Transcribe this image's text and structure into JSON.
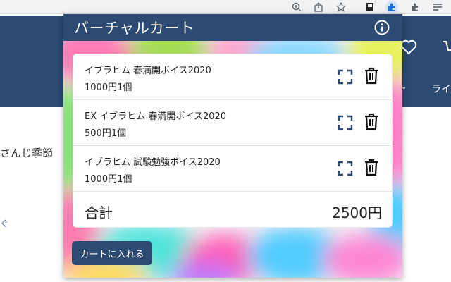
{
  "popup": {
    "title": "バーチャルカート",
    "items": [
      {
        "name": "イブラヒム 春満開ボイス2020",
        "price": "1000円",
        "quantity": "1個"
      },
      {
        "name": "EX イブラヒム 春満開ボイス2020",
        "price": "500円",
        "quantity": "1個"
      },
      {
        "name": "イブラヒム 試験勉強ボイス2020",
        "price": "1000円",
        "quantity": "1個"
      }
    ],
    "total_label": "合計",
    "total_value": "2500円",
    "add_to_cart_label": "カートに入れる"
  },
  "background_page": {
    "nav_text": "ライ",
    "body_text": "さんじ季節",
    "small_text": "ぐ"
  },
  "colors": {
    "header": "#2c4a72",
    "button": "#2c4a72",
    "card": "#ffffff"
  },
  "icons": [
    "zoom-icon",
    "share-icon",
    "star-icon",
    "extension-icon",
    "puzzle-icon",
    "menu-icon",
    "info-icon",
    "heart-icon",
    "cart-icon",
    "expand-icon",
    "trash-icon"
  ]
}
